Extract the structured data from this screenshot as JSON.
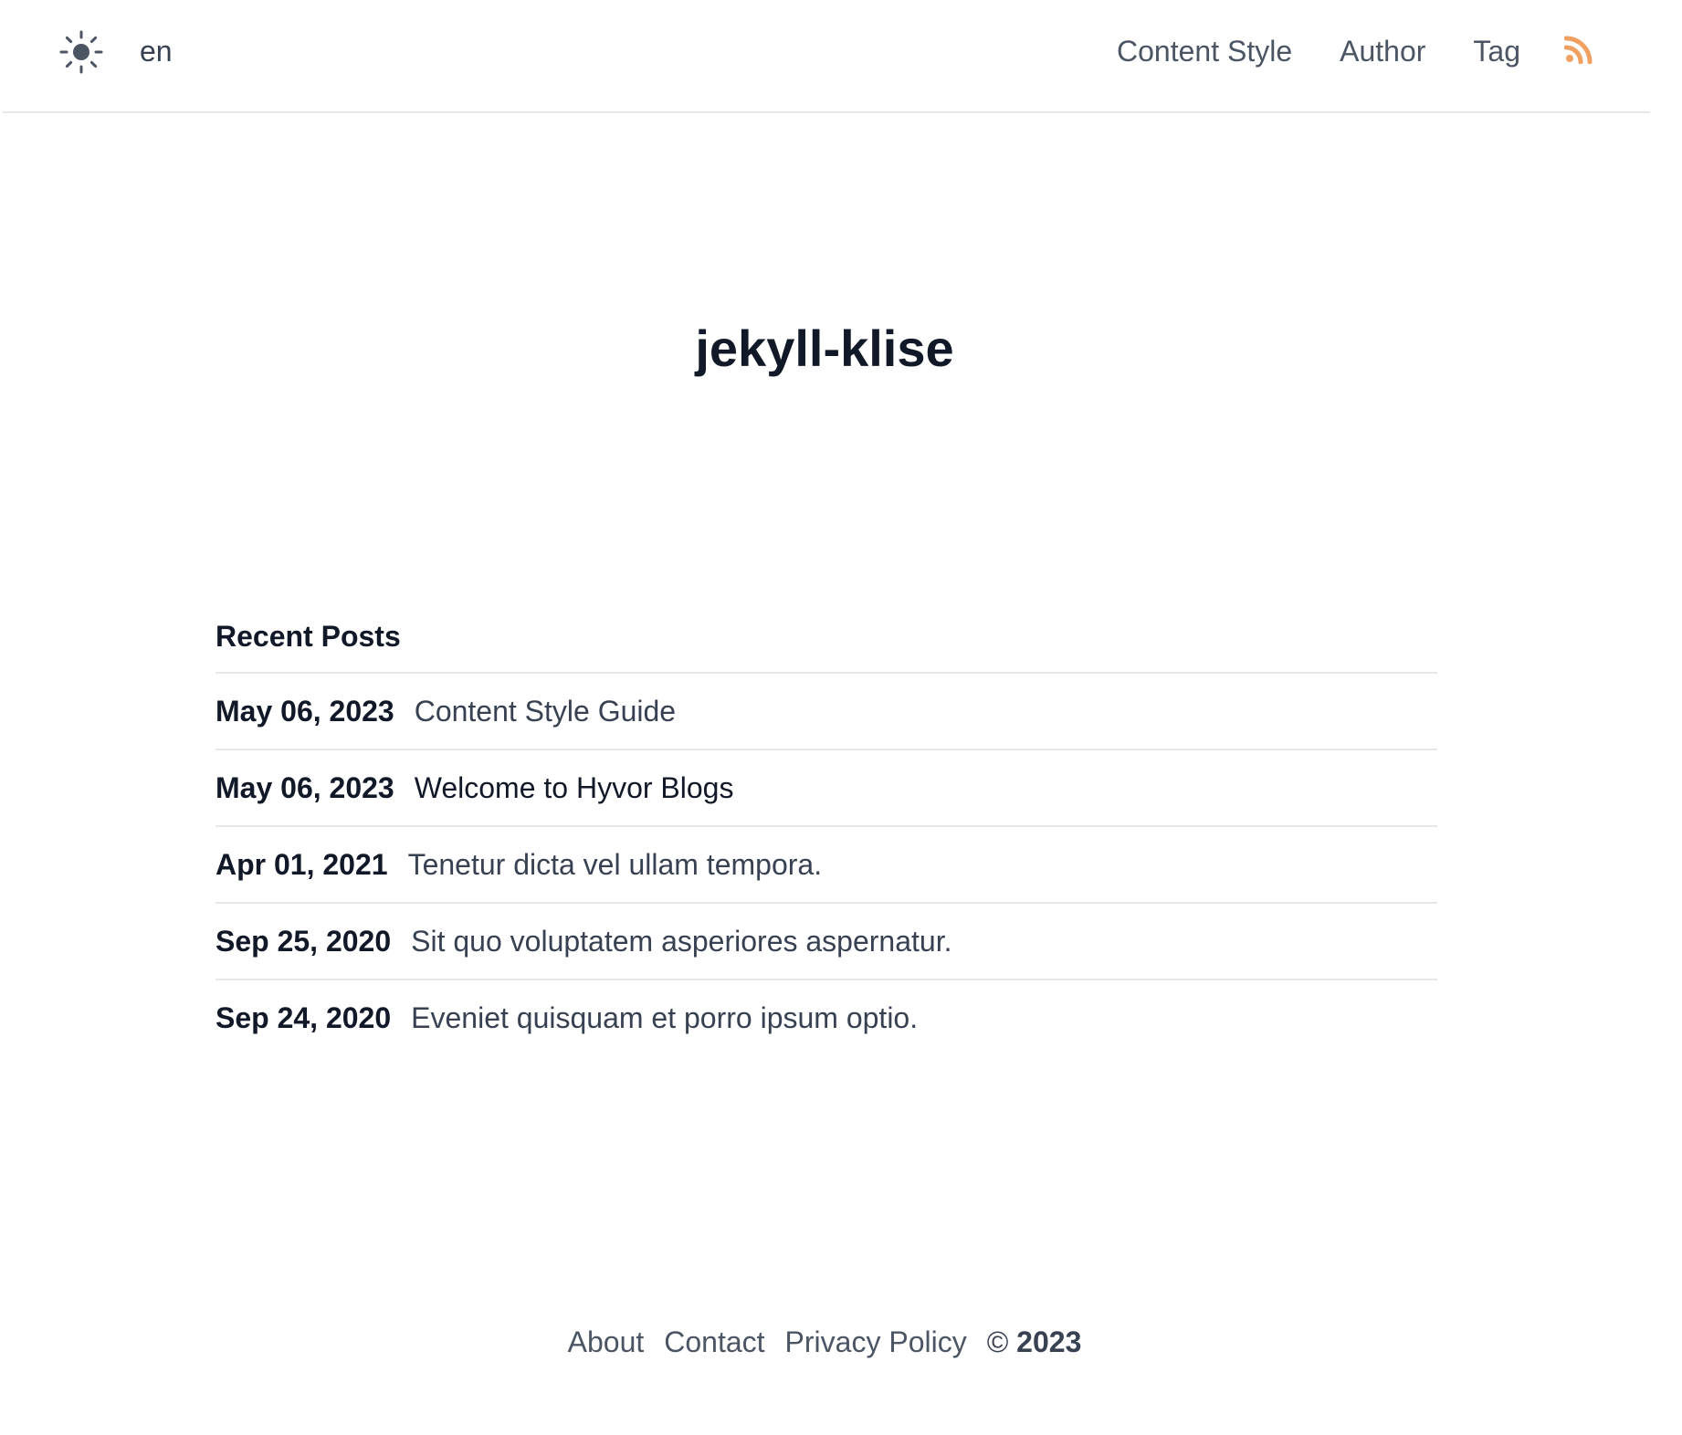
{
  "header": {
    "theme_icon": "sun-icon",
    "language": "en",
    "nav": [
      {
        "label": "Content Style"
      },
      {
        "label": "Author"
      },
      {
        "label": "Tag"
      }
    ],
    "rss_icon": "rss-icon",
    "rss_color": "#f0a060"
  },
  "site": {
    "title": "jekyll-klise"
  },
  "recent_posts": {
    "heading": "Recent Posts",
    "posts": [
      {
        "date": "May 06, 2023",
        "title": "Content Style Guide"
      },
      {
        "date": "May 06, 2023",
        "title": "Welcome to Hyvor Blogs"
      },
      {
        "date": "Apr 01, 2021",
        "title": "Tenetur dicta vel ullam tempora."
      },
      {
        "date": "Sep 25, 2020",
        "title": "Sit quo voluptatem asperiores aspernatur."
      },
      {
        "date": "Sep 24, 2020",
        "title": "Eveniet quisquam et porro ipsum optio."
      }
    ]
  },
  "footer": {
    "links": [
      {
        "label": "About"
      },
      {
        "label": "Contact"
      },
      {
        "label": "Privacy Policy"
      }
    ],
    "copyright_symbol": "©",
    "copyright_year": "2023"
  },
  "colors": {
    "text_dark": "#111827",
    "text_muted": "#4b5563",
    "border": "#e5e7eb",
    "rss": "#f0a060"
  }
}
